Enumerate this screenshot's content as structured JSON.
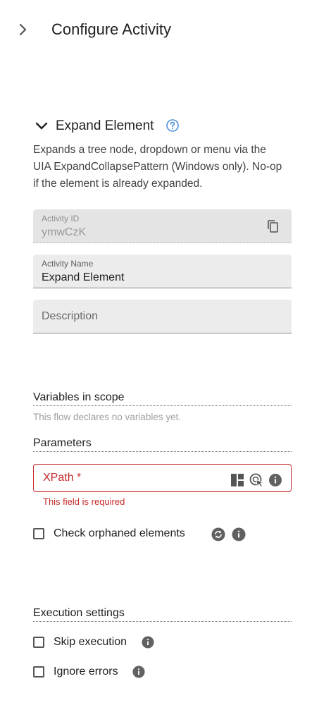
{
  "header": {
    "title": "Configure Activity"
  },
  "section": {
    "title": "Expand Element",
    "description": "Expands a tree node, dropdown or menu via the UIA ExpandCollapsePattern (Windows only). No-op if the element is already expanded."
  },
  "fields": {
    "activity_id": {
      "label": "Activity ID",
      "value": "ymwCzK"
    },
    "activity_name": {
      "label": "Activity Name",
      "value": "Expand Element"
    },
    "description": {
      "placeholder": "Description"
    }
  },
  "variables": {
    "heading": "Variables in scope",
    "empty_text": "This flow declares no variables yet."
  },
  "parameters": {
    "heading": "Parameters",
    "xpath_label": "XPath *",
    "xpath_error": "This field is required",
    "check_orphaned_label": "Check orphaned elements"
  },
  "execution": {
    "heading": "Execution settings",
    "skip_label": "Skip execution",
    "ignore_label": "Ignore errors"
  },
  "colors": {
    "error": "#c62828",
    "help_blue": "#4a90d9",
    "icon_gray": "#616161"
  }
}
